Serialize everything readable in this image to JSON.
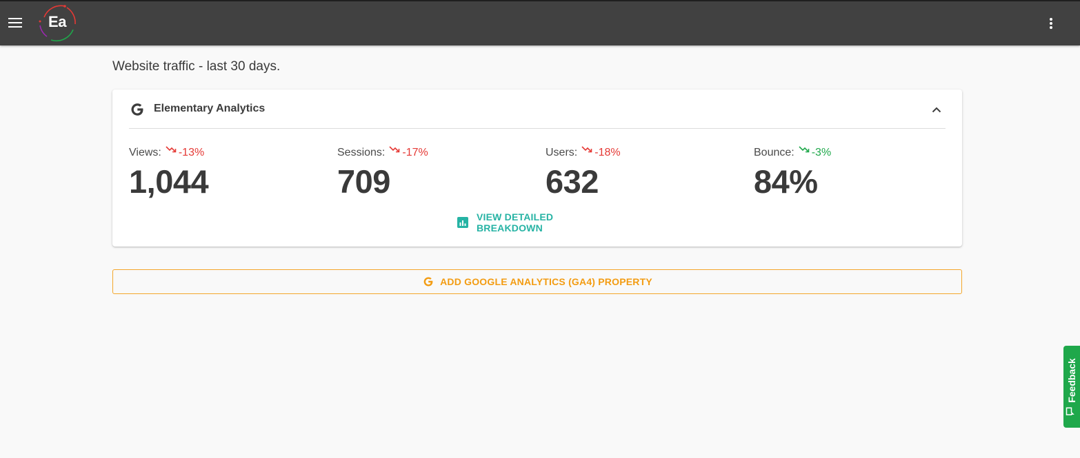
{
  "topbar": {
    "logo_text": "Ea",
    "menu_icon": "hamburger-menu-icon",
    "more_icon": "more-vertical-icon",
    "background": "#414141"
  },
  "page": {
    "title": "Website traffic - last 30 days."
  },
  "card": {
    "icon": "google-g-icon",
    "title": "Elementary Analytics",
    "collapse_icon": "chevron-up-icon",
    "metrics": [
      {
        "label": "Views:",
        "delta": "-13%",
        "value": "1,044",
        "trend": "down",
        "color": "#e53935"
      },
      {
        "label": "Sessions:",
        "delta": "-17%",
        "value": "709",
        "trend": "down",
        "color": "#e53935"
      },
      {
        "label": "Users:",
        "delta": "-18%",
        "value": "632",
        "trend": "down",
        "color": "#e53935"
      },
      {
        "label": "Bounce:",
        "delta": "-3%",
        "value": "84%",
        "trend": "down",
        "color": "#1fa84b"
      }
    ],
    "breakdown": {
      "icon": "bar-chart-icon",
      "label": "VIEW DETAILED BREAKDOWN",
      "color": "#26b3a4"
    }
  },
  "add_property": {
    "icon": "google-g-icon",
    "label": "ADD GOOGLE ANALYTICS (GA4) PROPERTY",
    "color": "#f39c12"
  },
  "feedback": {
    "icon": "feedback-icon",
    "label": "Feedback",
    "color": "#1fa84b"
  }
}
